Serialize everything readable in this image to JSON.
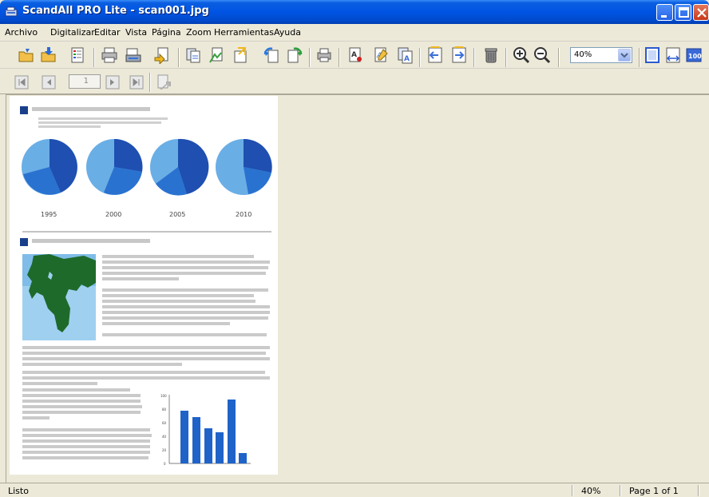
{
  "window": {
    "title": "ScandAll PRO Lite - scan001.jpg"
  },
  "menu": {
    "items": [
      {
        "label": "Archivo"
      },
      {
        "label": "Digitalizar"
      },
      {
        "label": "Editar"
      },
      {
        "label": "Vista"
      },
      {
        "label": "Página"
      },
      {
        "label": "Zoom"
      },
      {
        "label": "Herramientas"
      },
      {
        "label": "Ayuda"
      }
    ]
  },
  "toolbar": {
    "zoom_value": "40%"
  },
  "navigation": {
    "page_number": "1"
  },
  "document": {
    "pie_labels": [
      "1995",
      "2000",
      "2005",
      "2010"
    ],
    "bar_axis_ticks": [
      "100",
      "80",
      "60",
      "40",
      "20",
      "0"
    ]
  },
  "status": {
    "text": "Listo",
    "zoom": "40%",
    "page": "Page 1 of 1"
  },
  "colors": {
    "title_blue": "#0054e3",
    "chart_blue": "#1f63c9",
    "chart_light": "#6aaee6",
    "face": "#ece9d8"
  }
}
